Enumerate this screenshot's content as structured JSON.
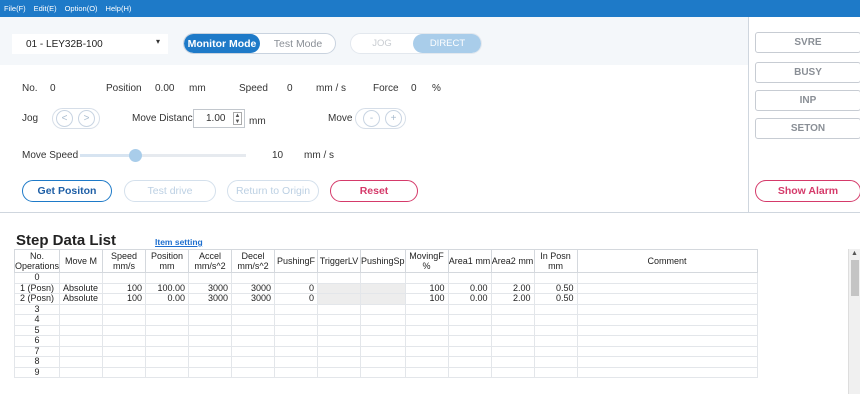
{
  "menu": [
    "File(F)",
    "Edit(E)",
    "Option(O)",
    "Help(H)"
  ],
  "axis": {
    "selected": "01 - LEY32B-100"
  },
  "mode": {
    "monitor": "Monitor Mode",
    "test": "Test Mode",
    "jog": "JOG",
    "direct": "DIRECT"
  },
  "readout": {
    "no_label": "No.",
    "no_value": "0",
    "position_label": "Position",
    "position_value": "0.00",
    "position_unit": "mm",
    "speed_label": "Speed",
    "speed_value": "0",
    "speed_unit": "mm / s",
    "force_label": "Force",
    "force_value": "0",
    "force_unit": "%"
  },
  "jog": {
    "label": "Jog",
    "left": "<",
    "right": ">",
    "move_distance_label": "Move Distance",
    "move_distance_value": "1.00",
    "move_distance_unit": "mm",
    "move_label": "Move",
    "minus": "-",
    "plus": "+"
  },
  "move_speed": {
    "label": "Move Speed",
    "value": "10",
    "unit": "mm / s",
    "level": 0.33
  },
  "buttons": {
    "get_position": "Get Positon",
    "test_drive": "Test drive",
    "return_origin": "Return to Origin",
    "reset": "Reset",
    "show_alarm": "Show Alarm"
  },
  "status": [
    "SVRE",
    "BUSY",
    "INP",
    "SETON"
  ],
  "step": {
    "title": "Step Data List",
    "item_setting": "Item setting",
    "columns": [
      "No. Operations",
      "Move M",
      "Speed mm/s",
      "Position mm",
      "Accel mm/s^2",
      "Decel mm/s^2",
      "PushingF",
      "TriggerLV",
      "PushingSp",
      "MovingF %",
      "Area1 mm",
      "Area2 mm",
      "In Posn mm",
      "Comment"
    ],
    "rows": [
      [
        "0",
        "",
        "",
        "",
        "",
        "",
        "",
        "",
        "",
        "",
        "",
        "",
        "",
        ""
      ],
      [
        "1 (Posn)",
        "Absolute",
        "100",
        "100.00",
        "3000",
        "3000",
        "0",
        "",
        "",
        "100",
        "0.00",
        "2.00",
        "0.50",
        ""
      ],
      [
        "2 (Posn)",
        "Absolute",
        "100",
        "0.00",
        "3000",
        "3000",
        "0",
        "",
        "",
        "100",
        "0.00",
        "2.00",
        "0.50",
        ""
      ],
      [
        "3",
        "",
        "",
        "",
        "",
        "",
        "",
        "",
        "",
        "",
        "",
        "",
        "",
        ""
      ],
      [
        "4",
        "",
        "",
        "",
        "",
        "",
        "",
        "",
        "",
        "",
        "",
        "",
        "",
        ""
      ],
      [
        "5",
        "",
        "",
        "",
        "",
        "",
        "",
        "",
        "",
        "",
        "",
        "",
        "",
        ""
      ],
      [
        "6",
        "",
        "",
        "",
        "",
        "",
        "",
        "",
        "",
        "",
        "",
        "",
        "",
        ""
      ],
      [
        "7",
        "",
        "",
        "",
        "",
        "",
        "",
        "",
        "",
        "",
        "",
        "",
        "",
        ""
      ],
      [
        "8",
        "",
        "",
        "",
        "",
        "",
        "",
        "",
        "",
        "",
        "",
        "",
        "",
        ""
      ],
      [
        "9",
        "",
        "",
        "",
        "",
        "",
        "",
        "",
        "",
        "",
        "",
        "",
        "",
        ""
      ]
    ]
  },
  "colors": {
    "accent": "#1e7ac8",
    "danger": "#d53a6a",
    "menubar": "#1e7ac8"
  }
}
